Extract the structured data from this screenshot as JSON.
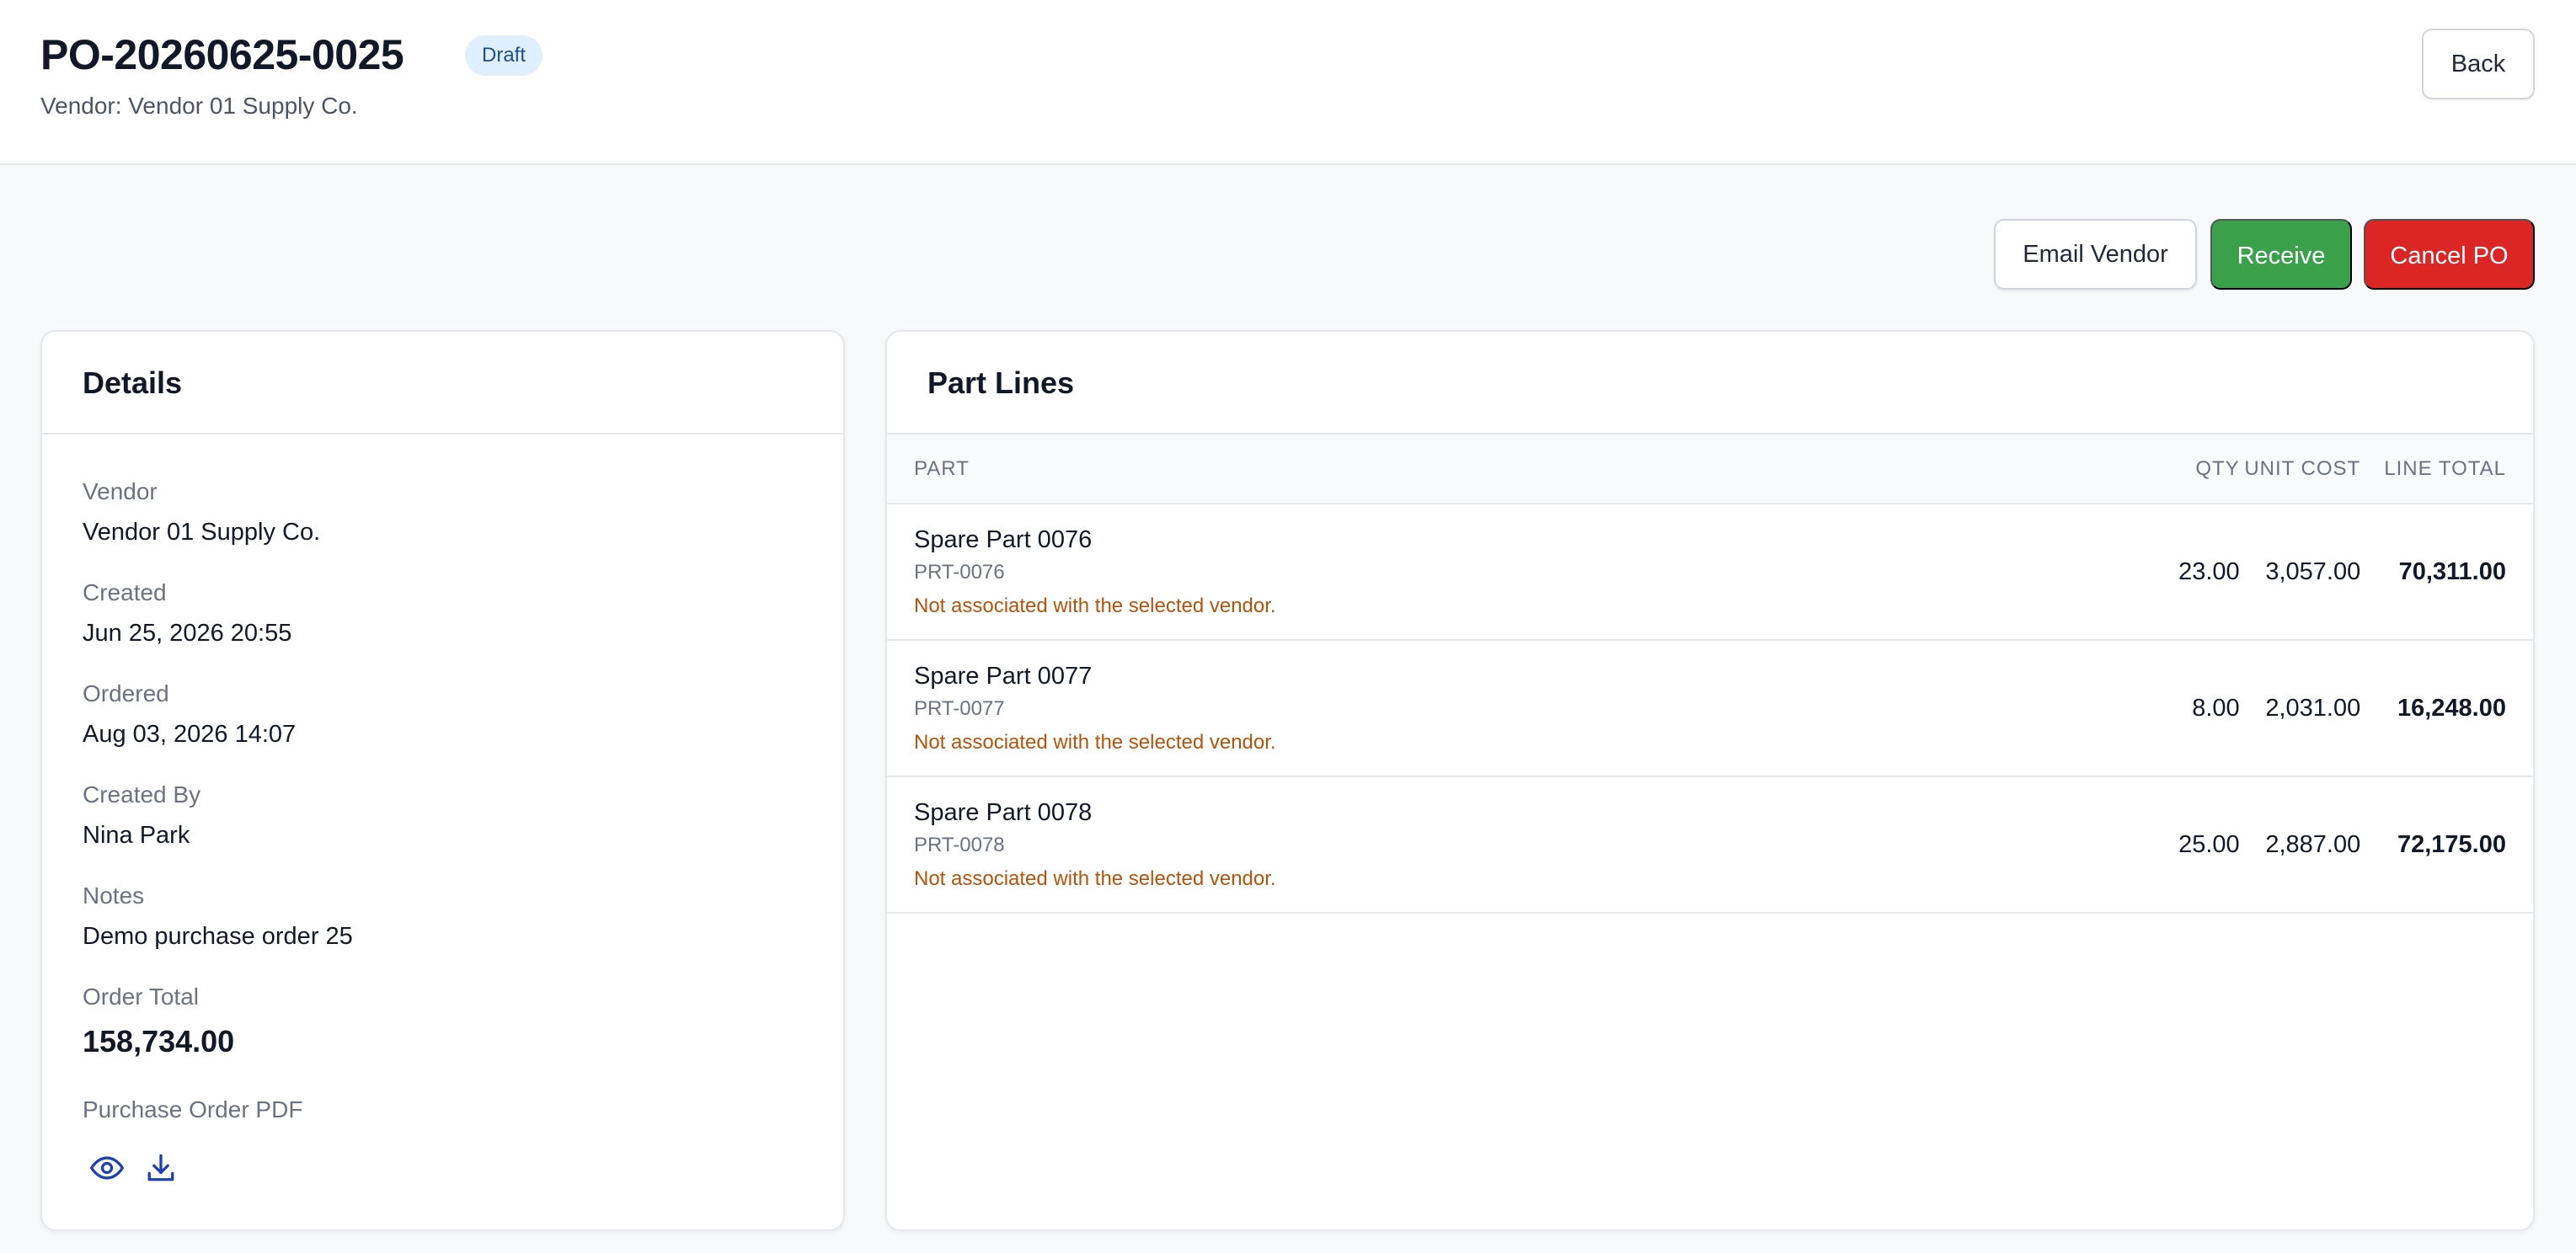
{
  "header": {
    "po_number": "PO-20260625-0025",
    "status": "Draft",
    "vendor_line": "Vendor: Vendor 01 Supply Co.",
    "back_label": "Back"
  },
  "actions": {
    "email_vendor": "Email Vendor",
    "receive": "Receive",
    "cancel_po": "Cancel PO"
  },
  "details": {
    "title": "Details",
    "vendor_label": "Vendor",
    "vendor_value": "Vendor 01 Supply Co.",
    "created_label": "Created",
    "created_value": "Jun 25, 2026 20:55",
    "ordered_label": "Ordered",
    "ordered_value": "Aug 03, 2026 14:07",
    "created_by_label": "Created By",
    "created_by_value": "Nina Park",
    "notes_label": "Notes",
    "notes_value": "Demo purchase order 25",
    "order_total_label": "Order Total",
    "order_total_value": "158,734.00",
    "pdf_label": "Purchase Order PDF"
  },
  "lines": {
    "title": "Part Lines",
    "columns": {
      "part": "PART",
      "qty": "QTY",
      "unit_cost": "UNIT COST",
      "line_total": "LINE TOTAL"
    },
    "rows": [
      {
        "name": "Spare Part 0076",
        "code": "PRT-0076",
        "warning": "Not associated with the selected vendor.",
        "qty": "23.00",
        "unit_cost": "3,057.00",
        "line_total": "70,311.00"
      },
      {
        "name": "Spare Part 0077",
        "code": "PRT-0077",
        "warning": "Not associated with the selected vendor.",
        "qty": "8.00",
        "unit_cost": "2,031.00",
        "line_total": "16,248.00"
      },
      {
        "name": "Spare Part 0078",
        "code": "PRT-0078",
        "warning": "Not associated with the selected vendor.",
        "qty": "25.00",
        "unit_cost": "2,887.00",
        "line_total": "72,175.00"
      }
    ]
  },
  "icons": {
    "view_pdf": "eye-icon",
    "download_pdf": "download-icon"
  },
  "colors": {
    "receive": "#3aa14a",
    "cancel": "#dc2626",
    "warning_text": "#b45309",
    "badge_bg": "#e0efff",
    "pdf_icons": "#1e40af"
  }
}
